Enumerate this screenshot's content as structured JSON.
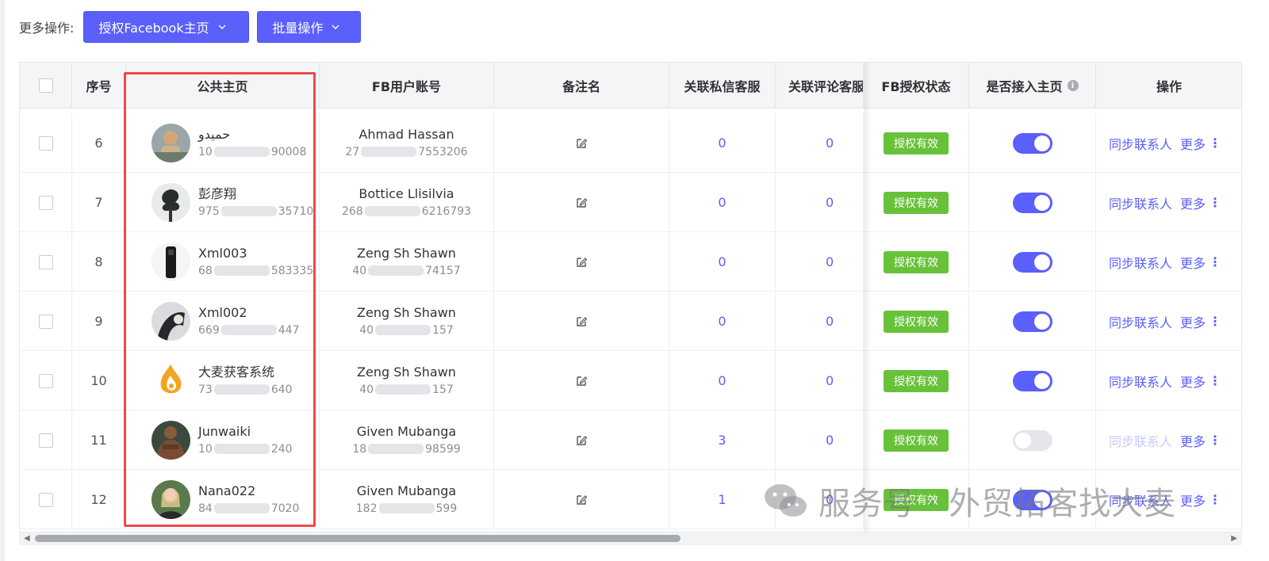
{
  "toolbar": {
    "label": "更多操作:",
    "auth_button": "授权Facebook主页",
    "batch_button": "批量操作"
  },
  "table": {
    "headers": {
      "seq": "序号",
      "public_page": "公共主页",
      "fb_account": "FB用户账号",
      "remark": "备注名",
      "dm_service": "关联私信客服",
      "comment_service": "关联评论客服",
      "auth_status": "FB授权状态",
      "connected": "是否接入主页",
      "actions": "操作"
    },
    "rows": [
      {
        "seq": "6",
        "page_name": "حميدو",
        "page_id_pre": "10",
        "page_id_post": "90008",
        "account_name": "Ahmad Hassan",
        "account_id_pre": "27",
        "account_id_post": "7553206",
        "dm": "0",
        "comment": "0",
        "status": "授权有效",
        "connected": true
      },
      {
        "seq": "7",
        "page_name": "彭彦翔",
        "page_id_pre": "975",
        "page_id_post": "35710",
        "account_name": "Bottice Llisilvia",
        "account_id_pre": "268",
        "account_id_post": "6216793",
        "dm": "0",
        "comment": "0",
        "status": "授权有效",
        "connected": true
      },
      {
        "seq": "8",
        "page_name": "Xml003",
        "page_id_pre": "68",
        "page_id_post": "583335",
        "account_name": "Zeng Sh Shawn",
        "account_id_pre": "40",
        "account_id_post": "74157",
        "dm": "0",
        "comment": "0",
        "status": "授权有效",
        "connected": true
      },
      {
        "seq": "9",
        "page_name": "Xml002",
        "page_id_pre": "669",
        "page_id_post": "447",
        "account_name": "Zeng Sh Shawn",
        "account_id_pre": "40",
        "account_id_post": "157",
        "dm": "0",
        "comment": "0",
        "status": "授权有效",
        "connected": true
      },
      {
        "seq": "10",
        "page_name": "大麦获客系统",
        "page_id_pre": "73",
        "page_id_post": "640",
        "account_name": "Zeng Sh Shawn",
        "account_id_pre": "40",
        "account_id_post": "157",
        "dm": "0",
        "comment": "0",
        "status": "授权有效",
        "connected": true
      },
      {
        "seq": "11",
        "page_name": "Junwaiki",
        "page_id_pre": "10",
        "page_id_post": "240",
        "account_name": "Given Mubanga",
        "account_id_pre": "18",
        "account_id_post": "98599",
        "dm": "3",
        "comment": "0",
        "status": "授权有效",
        "connected": false
      },
      {
        "seq": "12",
        "page_name": "Nana022",
        "page_id_pre": "84",
        "page_id_post": "7020",
        "account_name": "Given Mubanga",
        "account_id_pre": "182",
        "account_id_post": "599",
        "dm": "1",
        "comment": "0",
        "status": "授权有效",
        "connected": true
      }
    ],
    "sync_label": "同步联系人",
    "more_label": "更多",
    "kebab": "⋮",
    "info_icon": "i"
  },
  "watermark": {
    "text": "服务号 · 外贸拓客找大麦",
    "icon": "wechat-icon"
  },
  "colors": {
    "primary": "#5b5ffb",
    "success": "#67c23a",
    "highlight": "#f0484b",
    "header_bg": "#f4f5f7"
  }
}
